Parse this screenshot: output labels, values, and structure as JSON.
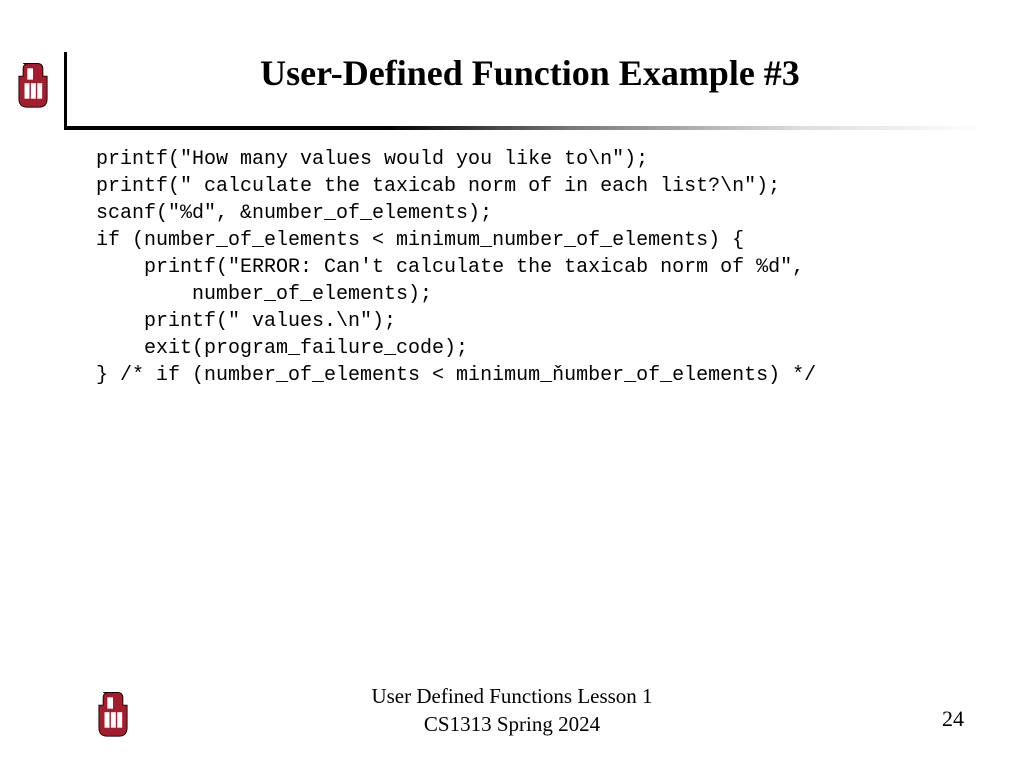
{
  "title": "User-Defined Function Example #3",
  "code": "printf(\"How many values would you like to\\n\");\nprintf(\" calculate the taxicab norm of in each list?\\n\");\nscanf(\"%d\", &number_of_elements);\nif (number_of_elements < minimum_number_of_elements) {\n    printf(\"ERROR: Can't calculate the taxicab norm of %d\",\n        number_of_elements);\n    printf(\" values.\\n\");\n    exit(program_failure_code);\n} /* if (number_of_elements < minimum_ňumber_of_elements) */",
  "footer": {
    "line1": "User Defined Functions Lesson 1",
    "line2": "CS1313 Spring 2024"
  },
  "page_number": "24",
  "logo": {
    "fill": "#a31d2c",
    "outline": "#000"
  }
}
